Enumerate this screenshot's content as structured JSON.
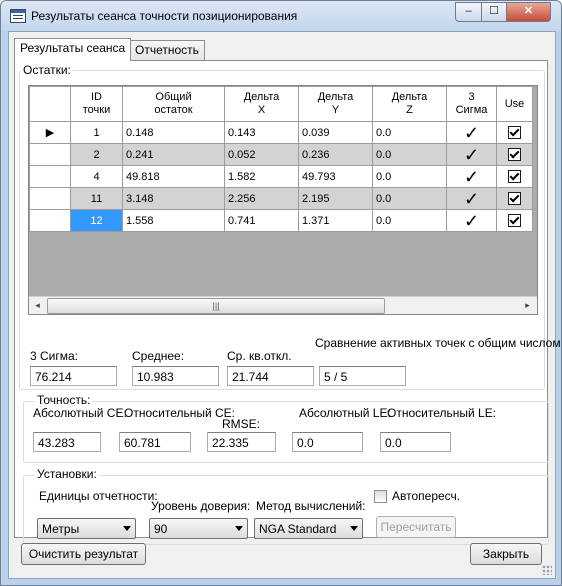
{
  "window": {
    "title": "Результаты сеанса точности позиционирования",
    "min_glyph": "‒",
    "max_glyph": "☐",
    "close_glyph": "✕"
  },
  "tabs": [
    {
      "label": "Результаты сеанса",
      "active": true
    },
    {
      "label": "Отчетность",
      "active": false
    }
  ],
  "residuals": {
    "label": "Остатки:",
    "columns": [
      "",
      "ID точки",
      "Общий остаток",
      "Дельта X",
      "Дельта Y",
      "Дельта Z",
      "3 Сигма",
      "Use"
    ],
    "rows": [
      {
        "id": "1",
        "total": "0.148",
        "dx": "0.143",
        "dy": "0.039",
        "dz": "0.0",
        "sigma": "✓",
        "use": true,
        "current": true
      },
      {
        "id": "2",
        "total": "0.241",
        "dx": "0.052",
        "dy": "0.236",
        "dz": "0.0",
        "sigma": "✓",
        "use": true
      },
      {
        "id": "4",
        "total": "49.818",
        "dx": "1.582",
        "dy": "49.793",
        "dz": "0.0",
        "sigma": "✓",
        "use": true
      },
      {
        "id": "11",
        "total": "3.148",
        "dx": "2.256",
        "dy": "2.195",
        "dz": "0.0",
        "sigma": "✓",
        "use": true
      },
      {
        "id": "12",
        "total": "1.558",
        "dx": "0.741",
        "dy": "1.371",
        "dz": "0.0",
        "sigma": "✓",
        "use": true,
        "selected": true
      }
    ],
    "row_indicator": "▶",
    "scroll": {
      "left_arrow": "◂",
      "right_arrow": "▸",
      "thumb_grip": "|||"
    }
  },
  "summary": {
    "comparison_text": "Сравнение активных точек с общим числом т",
    "sigma_label": "3 Сигма:",
    "sigma_value": "76.214",
    "mean_label": "Среднее:",
    "mean_value": "10.983",
    "rms_label": "Ср. кв.откл.",
    "rms_value": "21.744",
    "active_ratio": "5 / 5"
  },
  "accuracy": {
    "label": "Точность:",
    "abs_ce_label": "Абсолютный CE:",
    "abs_ce_value": "43.283",
    "rel_ce_label": "Относительный CE:",
    "rel_ce_value": "60.781",
    "rmse_label": "RMSE:",
    "rmse_value": "22.335",
    "abs_le_label": "Абсолютный LE:",
    "abs_le_value": "0.0",
    "rel_le_label": "Относительный LE:",
    "rel_le_value": "0.0"
  },
  "settings": {
    "label": "Установки:",
    "units_label": "Единицы отчетности:",
    "units_value": "Метры",
    "confidence_label": "Уровень доверия:",
    "confidence_value": "90",
    "method_label": "Метод вычислений:",
    "method_value": "NGA Standard",
    "auto_label": "Автопересч.",
    "auto_checked": false,
    "recalc_label": "Пересчитать"
  },
  "footer": {
    "clear_label": "Очистить результат",
    "close_label": "Закрыть"
  }
}
